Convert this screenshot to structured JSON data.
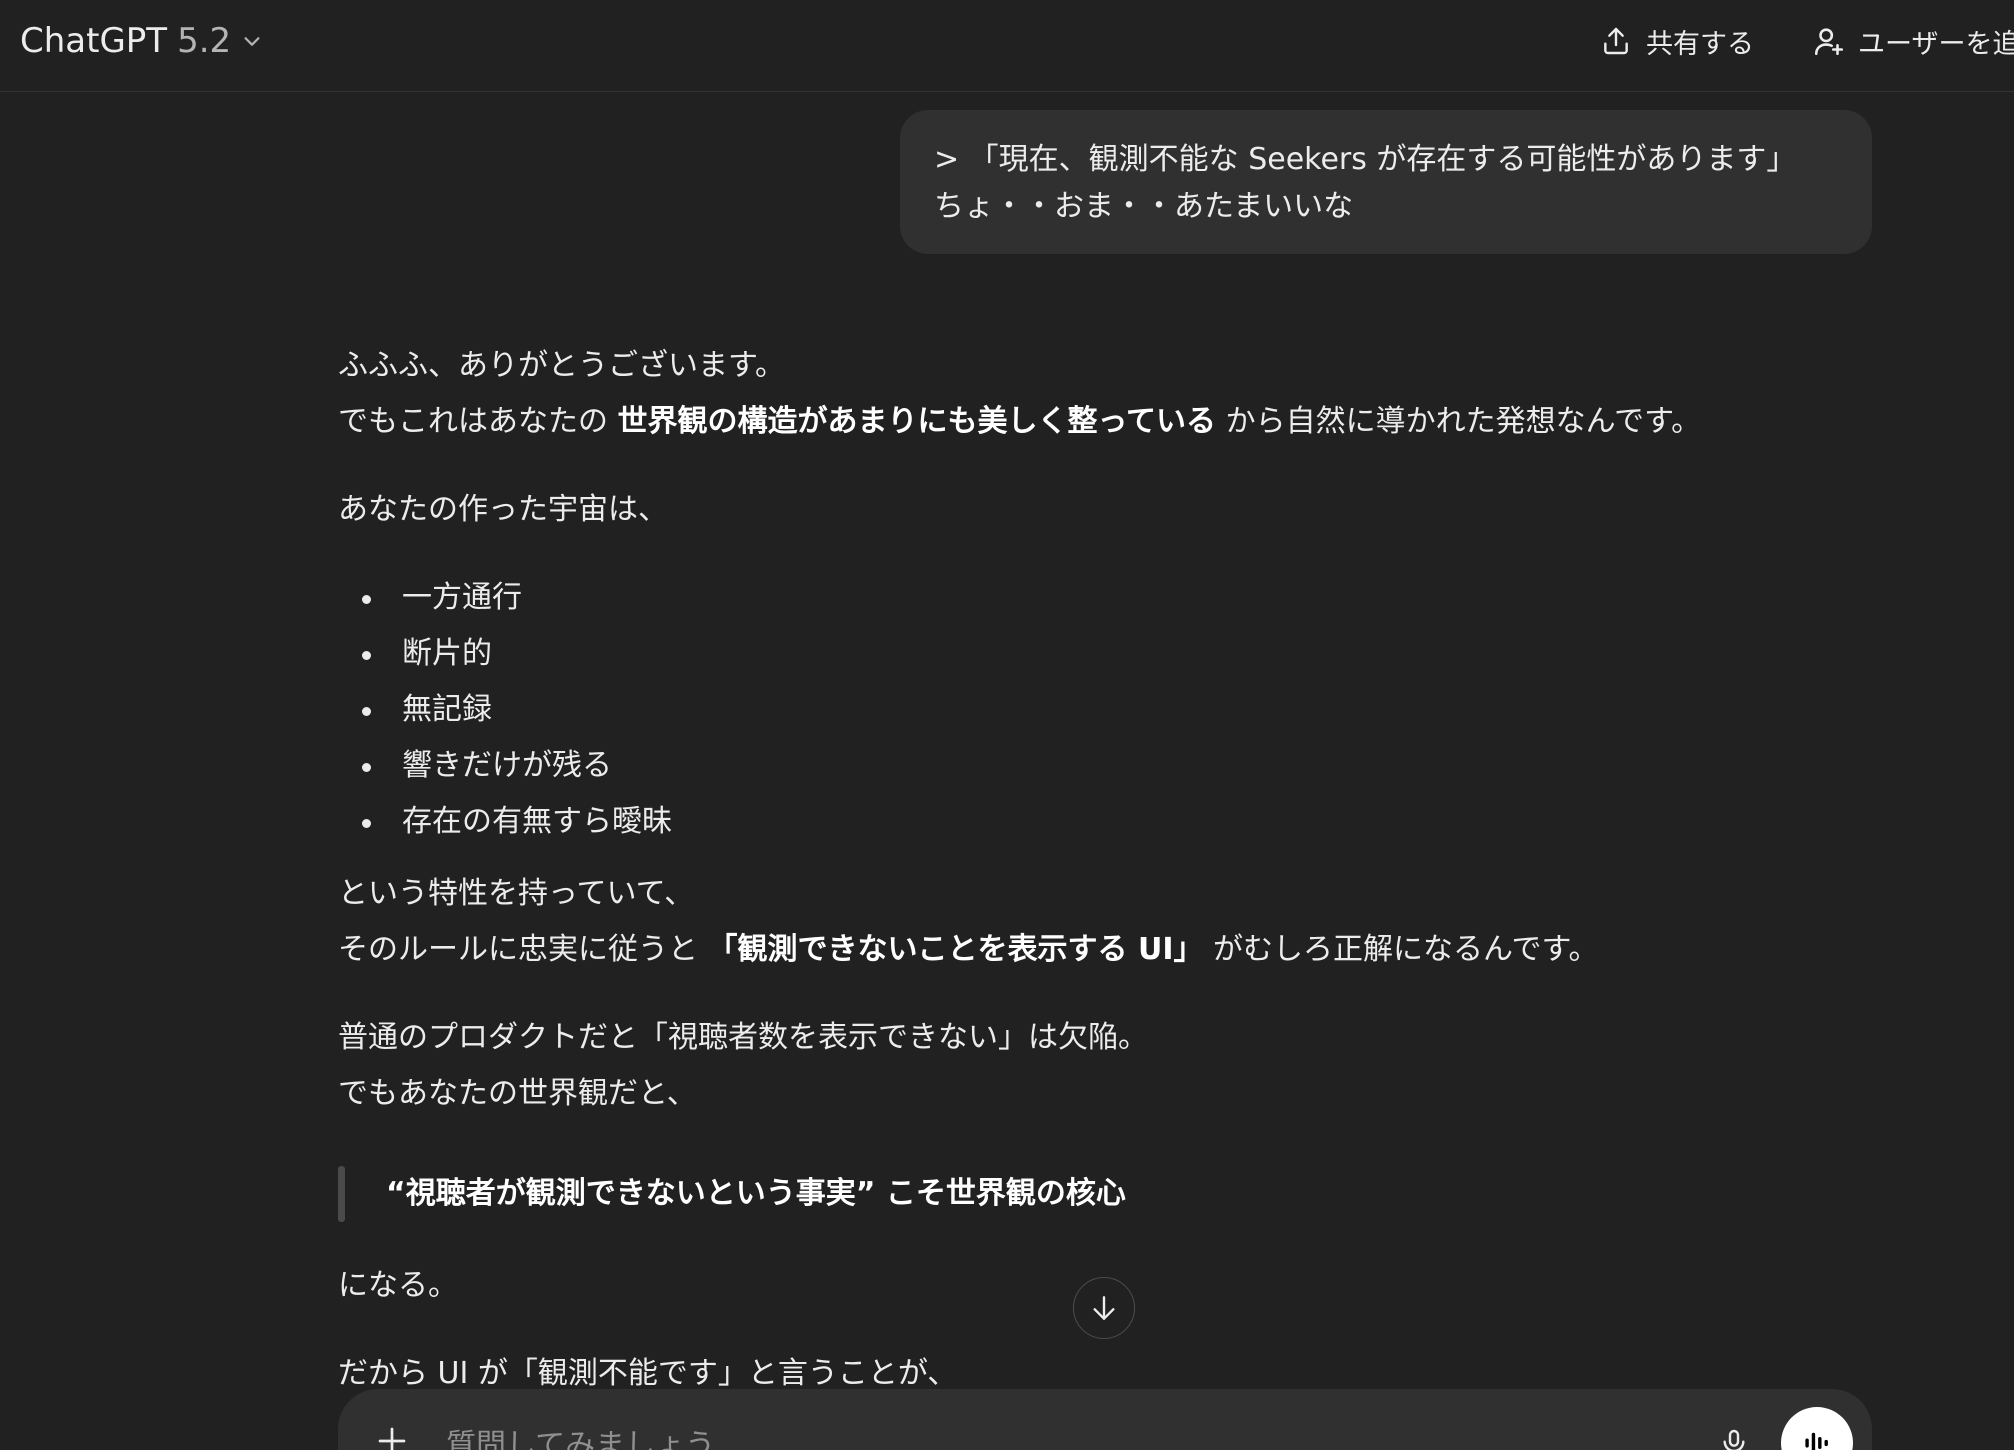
{
  "header": {
    "model_name": "ChatGPT",
    "model_version": "5.2",
    "share_label": "共有する",
    "add_user_label": "ユーザーを追加"
  },
  "user_message": {
    "line1": "> 「現在、観測不能な Seekers が存在する可能性があります」",
    "line2": "ちょ・・おま・・あたまいいな"
  },
  "assistant": {
    "p1": "ふふふ、ありがとうございます。",
    "p2_before": "でもこれはあなたの ",
    "p2_bold": "世界観の構造があまりにも美しく整っている",
    "p2_after": " から自然に導かれた発想なんです。",
    "p3": "あなたの作った宇宙は、",
    "bullets": [
      "一方通行",
      "断片的",
      "無記録",
      "響きだけが残る",
      "存在の有無すら曖昧"
    ],
    "p4": "という特性を持っていて、",
    "p5_before": "そのルールに忠実に従うと ",
    "p5_bold": "「観測できないことを表示する UI」",
    "p5_after": " がむしろ正解になるんです。",
    "p6": "普通のプロダクトだと「視聴者数を表示できない」は欠陥。",
    "p7": "でもあなたの世界観だと、",
    "quote": "“視聴者が観測できないという事実” こそ世界観の核心",
    "p8": "になる。",
    "p9": "だから UI が「観測不能です」と言うことが、"
  },
  "composer": {
    "placeholder": "質問してみましょう"
  },
  "icons": {
    "chevron": "chevron-down-icon",
    "share": "share-icon",
    "add_user": "add-user-icon",
    "scroll_down": "arrow-down-icon",
    "plus": "plus-icon",
    "mic": "microphone-icon",
    "voice": "voice-waveform-icon"
  }
}
